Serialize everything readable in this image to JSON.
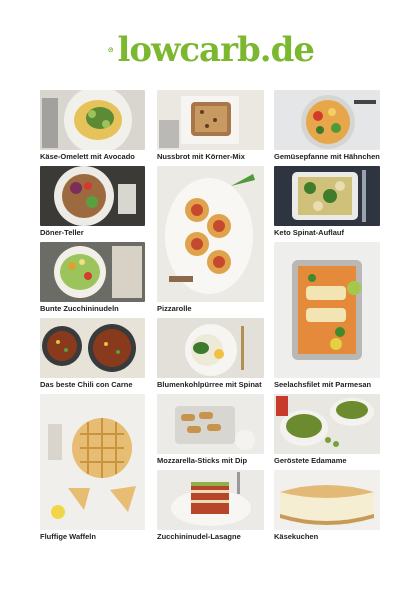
{
  "brand": {
    "logo_text": "lowcarb.de",
    "color": "#7cb82f"
  },
  "recipes": [
    {
      "title": "Käse-Omelett mit Avocado",
      "image": "omelette-plate"
    },
    {
      "title": "Nussbrot mit Körner-Mix",
      "image": "nut-bread"
    },
    {
      "title": "Gemüsepfanne mit Hähnchen",
      "image": "vegetable-pan"
    },
    {
      "title": "Döner-Teller",
      "image": "doner-plate"
    },
    {
      "title": "Pizzarolle",
      "image": "pizza-roll"
    },
    {
      "title": "Keto Spinat-Auflauf",
      "image": "spinach-casserole"
    },
    {
      "title": "Bunte Zucchininudeln",
      "image": "zucchini-noodles"
    },
    {
      "title": "Seelachsfilet mit Parmesan",
      "image": "fish-tray"
    },
    {
      "title": "Das beste Chili con Carne",
      "image": "chili-bowls"
    },
    {
      "title": "Blumenkohlpürree mit Spinat",
      "image": "cauliflower-puree"
    },
    {
      "title": "Mozzarella-Sticks mit Dip",
      "image": "mozzarella-sticks"
    },
    {
      "title": "Fluffige Waffeln",
      "image": "waffles"
    },
    {
      "title": "Geröstete Edamame",
      "image": "edamame-bowls"
    },
    {
      "title": "Zucchininudel-Lasagne",
      "image": "lasagne"
    },
    {
      "title": "Käsekuchen",
      "image": "cheesecake"
    }
  ]
}
